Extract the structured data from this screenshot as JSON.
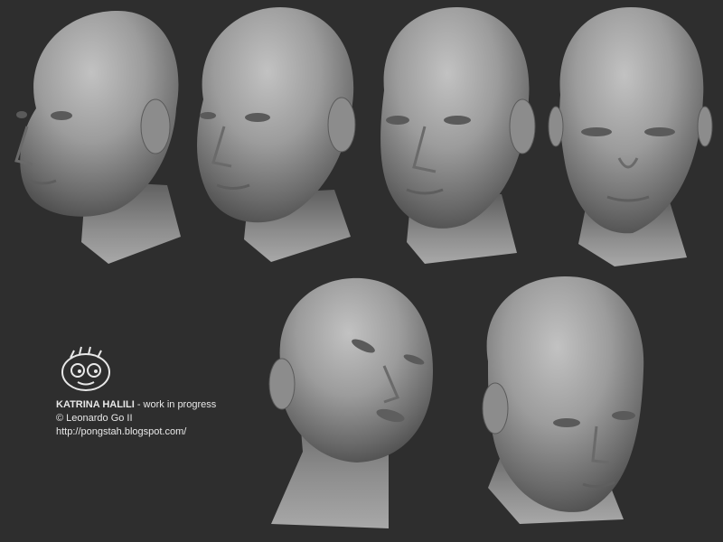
{
  "caption": {
    "title": "KATRINA HALILI",
    "subtitle": " - work in progress",
    "copyright": "© Leonardo Go II",
    "url": "http://pongstah.blogspot.com/"
  },
  "colors": {
    "background": "#2e2e2e",
    "clay_light": "#b9b9b9",
    "clay_mid": "#8a8a8a",
    "clay_dark": "#454545",
    "text": "#e8e8e8"
  },
  "logo": {
    "icon": "cartoon-face-icon"
  }
}
